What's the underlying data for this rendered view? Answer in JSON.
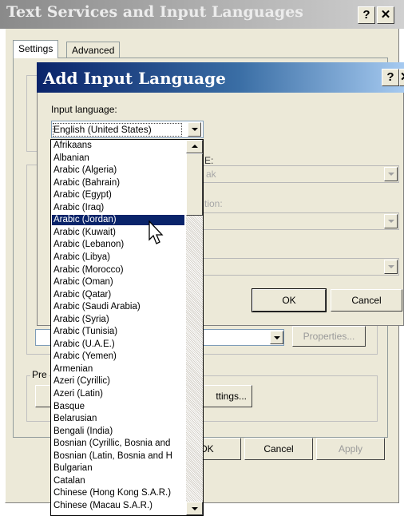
{
  "back_window": {
    "title": "Text Services and Input Languages",
    "help_label": "?",
    "close_label": "✕",
    "tabs": [
      {
        "label": "Settings"
      },
      {
        "label": "Advanced"
      }
    ],
    "preferences_group_label": "Pre",
    "key_settings_label": "ttings...",
    "properties_label": "Properties...",
    "ok_label": "OK",
    "cancel_label": "Cancel",
    "apply_label": "Apply"
  },
  "dialog": {
    "title": "Add Input Language",
    "help_label": "?",
    "close_label": "✕",
    "input_language_label": "Input language:",
    "input_language_value": "English (United States)",
    "partial_label_1": "E:",
    "partial_value_1": "ak",
    "partial_label_2": "tion:",
    "ok_label": "OK",
    "cancel_label": "Cancel"
  },
  "language_list": {
    "selected_index": 6,
    "items": [
      "Afrikaans",
      "Albanian",
      "Arabic (Algeria)",
      "Arabic (Bahrain)",
      "Arabic (Egypt)",
      "Arabic (Iraq)",
      "Arabic (Jordan)",
      "Arabic (Kuwait)",
      "Arabic (Lebanon)",
      "Arabic (Libya)",
      "Arabic (Morocco)",
      "Arabic (Oman)",
      "Arabic (Qatar)",
      "Arabic (Saudi Arabia)",
      "Arabic (Syria)",
      "Arabic (Tunisia)",
      "Arabic (U.A.E.)",
      "Arabic (Yemen)",
      "Armenian",
      "Azeri (Cyrillic)",
      "Azeri (Latin)",
      "Basque",
      "Belarusian",
      "Bengali (India)",
      "Bosnian (Cyrillic, Bosnia and",
      "Bosnian (Latin, Bosnia and H",
      "Bulgarian",
      "Catalan",
      "Chinese (Hong Kong S.A.R.)",
      "Chinese (Macau S.A.R.)"
    ]
  }
}
